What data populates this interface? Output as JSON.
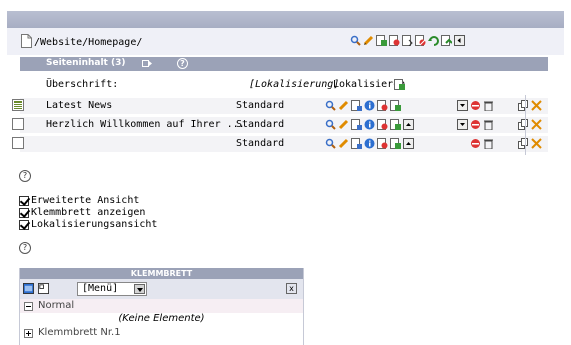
{
  "path": "/Website/Homepage/",
  "section": {
    "title": "Seiteninhalt (3)",
    "help_symbol": "?"
  },
  "heading_row": {
    "label": "Überschrift:",
    "localization": "[Lokalisierung]",
    "localize_action": "Lokalisieren"
  },
  "rows": [
    {
      "title": "Latest News",
      "type": "Standard"
    },
    {
      "title": "Herzlich Willkommen auf Ihrer ...",
      "type": "Standard"
    },
    {
      "title": "",
      "type": "Standard"
    }
  ],
  "options": {
    "help_symbol": "?",
    "checkboxes": [
      {
        "label": "Erweiterte Ansicht",
        "checked": true
      },
      {
        "label": "Klemmbrett anzeigen",
        "checked": true
      },
      {
        "label": "Lokalisierungsansicht",
        "checked": true
      }
    ]
  },
  "clipboard": {
    "title": "KLEMMBRETT",
    "menu_value": "[Menü]",
    "close_symbol": "x",
    "normal_label": "Normal",
    "empty_label": "(Keine Elemente)",
    "entry_label": "Klemmbrett Nr.1"
  },
  "colors": {
    "header_band": "#9ba2b7",
    "row_bg": "#f3f3f6",
    "topbar": "#b0b7ca"
  }
}
